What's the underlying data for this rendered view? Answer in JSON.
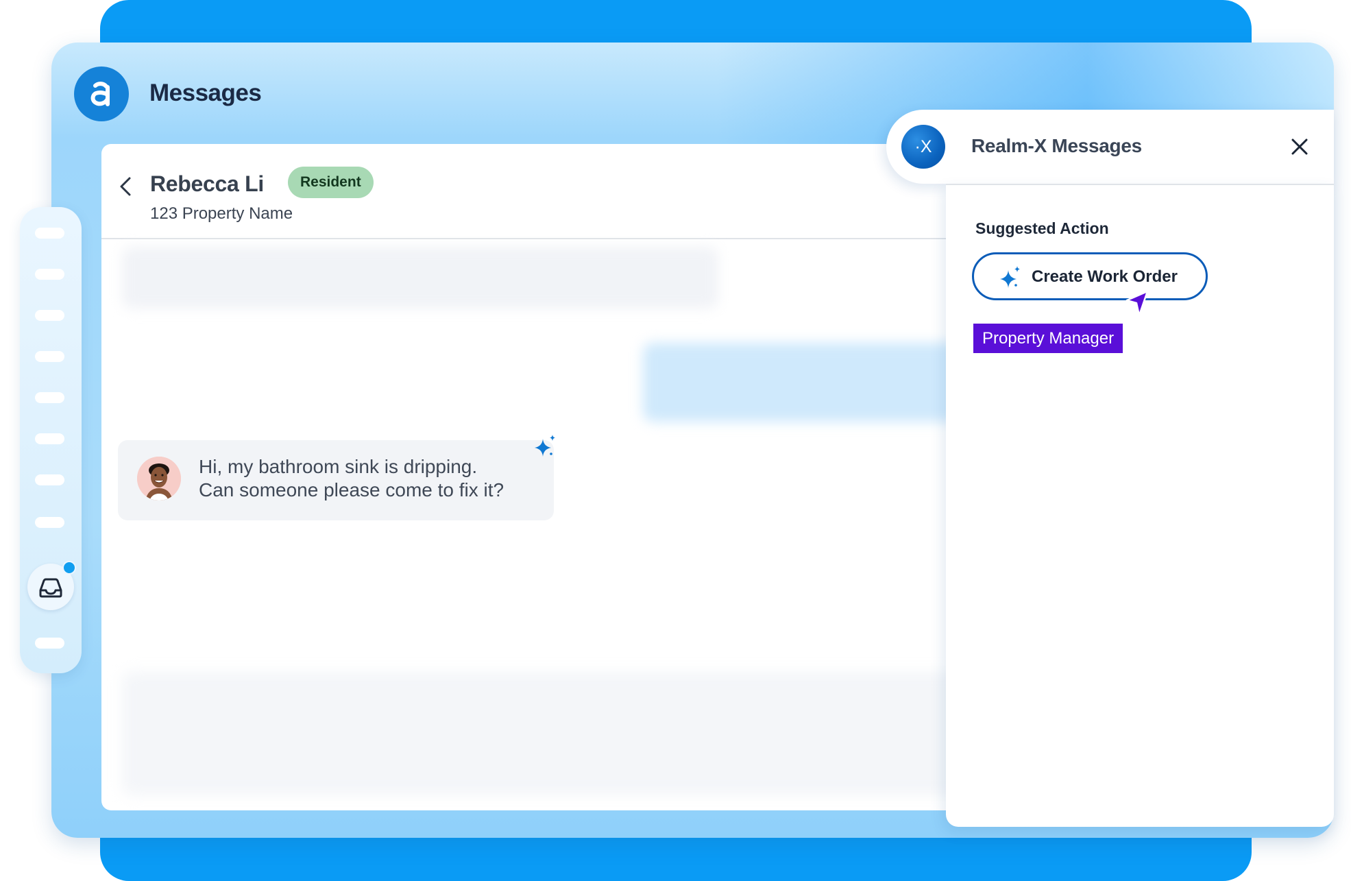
{
  "app": {
    "title": "Messages",
    "logo_icon": "a-logo-icon",
    "brand_color": "#1582d8"
  },
  "conversation": {
    "contact_name": "Rebecca Li",
    "badge": "Resident",
    "property": "123 Property Name",
    "message_lines": [
      "Hi, my bathroom sink is dripping.",
      "Can someone please come to fix it?"
    ]
  },
  "realm_x": {
    "logo_text": "·X",
    "title": "Realm-X Messages",
    "suggested_heading": "Suggested Action",
    "action_label": "Create Work Order",
    "cursor_label": "Property Manager",
    "label_color": "#5a0fd8"
  },
  "sidebar": {
    "nav_item_count": 9,
    "active_icon": "inbox-icon",
    "has_notification": true
  }
}
